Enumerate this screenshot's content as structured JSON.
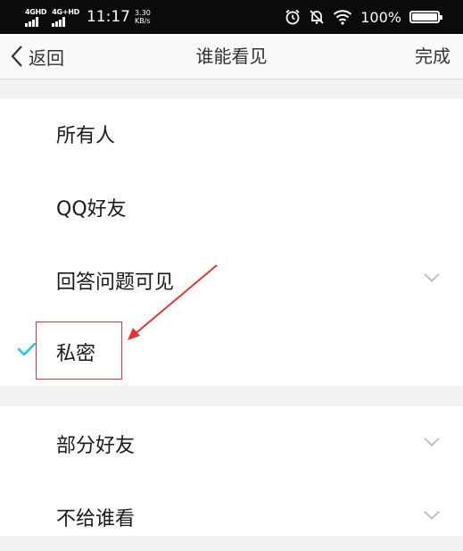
{
  "status_bar": {
    "network1": "4GHD",
    "network2": "4G+HD",
    "time": "11:17",
    "speed_value": "3.30",
    "speed_unit": "KB/s",
    "battery_percent": "100%",
    "battery_level": 1.0,
    "icons": [
      "alarm-icon",
      "mute-icon",
      "wifi-icon",
      "battery-icon"
    ]
  },
  "nav": {
    "back_label": "返回",
    "title": "谁能看见",
    "done_label": "完成"
  },
  "options": [
    {
      "label": "所有人",
      "selected": false,
      "has_chevron": false
    },
    {
      "label": "QQ好友",
      "selected": false,
      "has_chevron": false
    },
    {
      "label": "回答问题可见",
      "selected": false,
      "has_chevron": true
    },
    {
      "label": "私密",
      "selected": true,
      "has_chevron": false
    },
    {
      "label": "部分好友",
      "selected": false,
      "has_chevron": true
    },
    {
      "label": "不给谁看",
      "selected": false,
      "has_chevron": true
    }
  ],
  "colors": {
    "check": "#1ec8ea",
    "annotation": "#e53333",
    "status_bar_bg": "#0b0b0b",
    "background": "#f2f2f2"
  }
}
